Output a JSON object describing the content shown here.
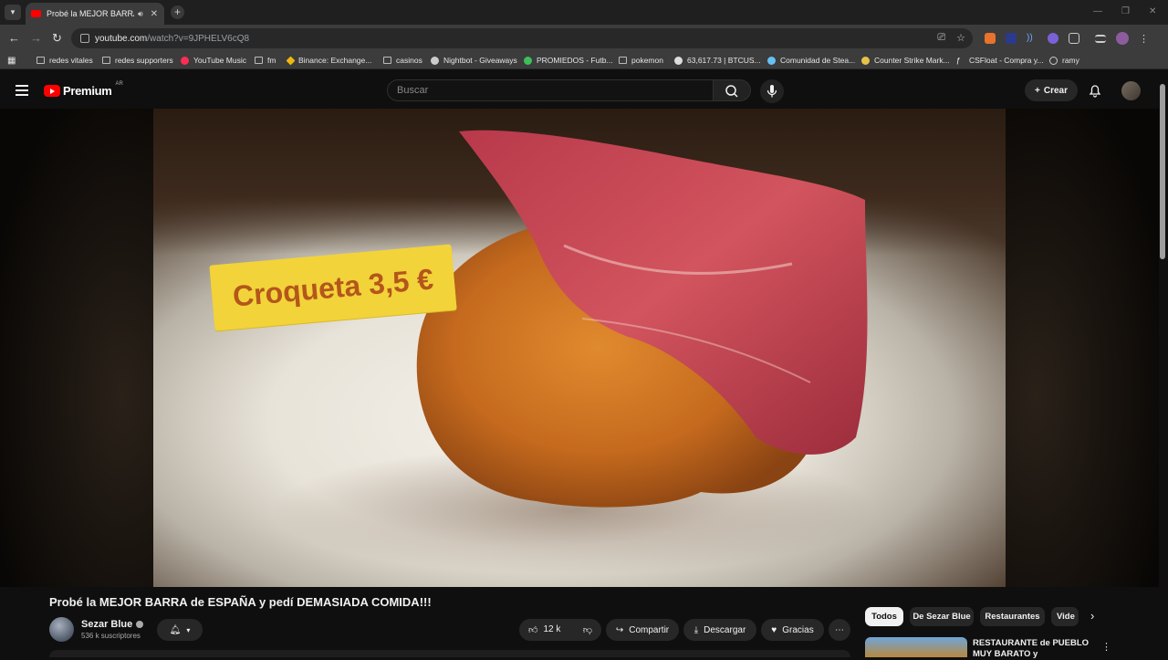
{
  "browser": {
    "tab": {
      "title": "Probé la MEJOR BARRA de",
      "audio_icon": "speaker-icon",
      "close": "✕"
    },
    "new_tab": "+",
    "window_controls": [
      "—",
      "❐",
      "✕"
    ],
    "url": {
      "host": "youtube.com",
      "path": "/watch?v=9JPHELV6cQ8"
    },
    "bookmarks": [
      {
        "label": "redes vitales",
        "icon": "folder-icon"
      },
      {
        "label": "redes supporters",
        "icon": "folder-icon"
      },
      {
        "label": "YouTube Music",
        "icon": "youtube-music-icon"
      },
      {
        "label": "fm",
        "icon": "folder-icon"
      },
      {
        "label": "Binance: Exchange...",
        "icon": "binance-icon"
      },
      {
        "label": "casinos",
        "icon": "folder-icon"
      },
      {
        "label": "Nightbot - Giveaways",
        "icon": "nightbot-icon"
      },
      {
        "label": "PROMIEDOS - Futb...",
        "icon": "promiedos-icon"
      },
      {
        "label": "pokemon",
        "icon": "folder-icon"
      },
      {
        "label": "63,617.73 | BTCUS...",
        "icon": "tradingview-icon"
      },
      {
        "label": "Comunidad de Stea...",
        "icon": "steam-icon"
      },
      {
        "label": "Counter Strike Mark...",
        "icon": "csmarket-icon"
      },
      {
        "label": "CSFloat - Compra y...",
        "icon": "csfloat-icon"
      },
      {
        "label": "ramy",
        "icon": "globe-icon"
      }
    ]
  },
  "youtube": {
    "logo_text": "Premium",
    "country": "AR",
    "search_placeholder": "Buscar",
    "create_label": "Crear",
    "video": {
      "overlay_text": "Croqueta 3,5 €",
      "title": "Probé la MEJOR BARRA de ESPAÑA y pedí DEMASIADA COMIDA!!!",
      "channel": "Sezar Blue",
      "subscribers": "536 k suscriptores",
      "likes": "12 k",
      "share_label": "Compartir",
      "download_label": "Descargar",
      "thanks_label": "Gracias",
      "more": "⋯"
    },
    "chips": [
      {
        "label": "Todos",
        "active": true
      },
      {
        "label": "De Sezar Blue",
        "active": false
      },
      {
        "label": "Restaurantes",
        "active": false
      },
      {
        "label": "Vide",
        "active": false
      }
    ],
    "recommendation": {
      "title": "RESTAURANTE de PUEBLO MUY BARATO y"
    }
  },
  "colors": {
    "accent": "#ff0000",
    "chip_active_bg": "#f1f1f1",
    "price_tag": "#f2d33a",
    "price_text": "#b4561b"
  }
}
